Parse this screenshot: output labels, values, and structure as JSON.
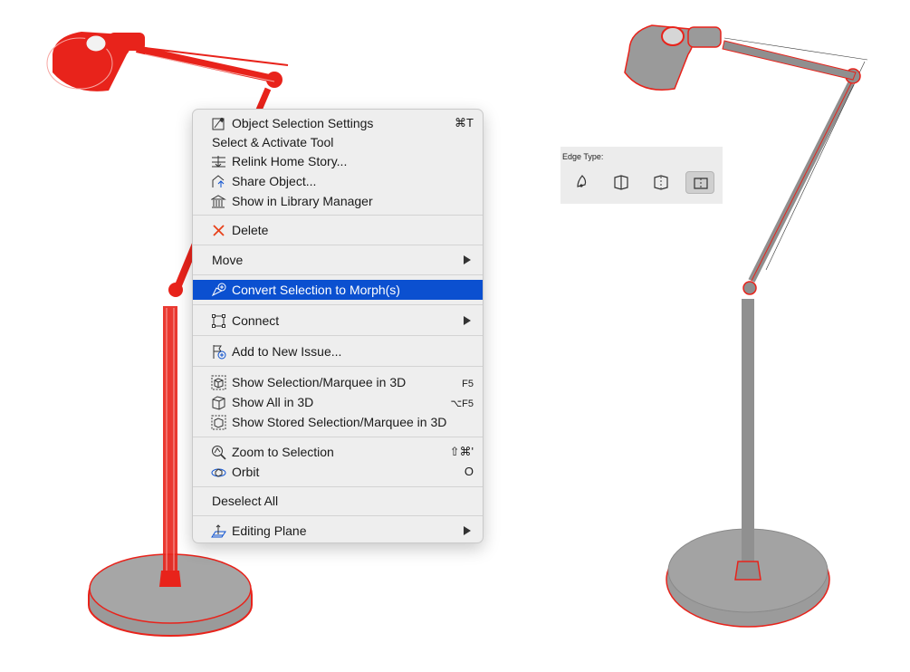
{
  "colors": {
    "accent": "#0b50d0",
    "selection_edge": "#e8231b",
    "model_fill": "#9b9b9b"
  },
  "context_menu": {
    "groups": [
      [
        {
          "label": "Object Selection Settings",
          "shortcut": "⌘T",
          "icon": "object-settings-icon"
        },
        {
          "label": "Select & Activate Tool",
          "shortcut": "",
          "icon": ""
        },
        {
          "label": "Relink Home Story...",
          "shortcut": "",
          "icon": "relink-story-icon"
        },
        {
          "label": "Share Object...",
          "shortcut": "",
          "icon": "share-object-icon"
        },
        {
          "label": "Show in Library Manager",
          "shortcut": "",
          "icon": "library-manager-icon"
        }
      ],
      [
        {
          "label": "Delete",
          "shortcut": "",
          "icon": "delete-x-icon"
        }
      ],
      [
        {
          "label": "Move",
          "submenu": true,
          "icon": ""
        }
      ],
      [
        {
          "label": "Convert Selection to Morph(s)",
          "highlighted": true,
          "icon": "convert-morph-icon"
        }
      ],
      [
        {
          "label": "Connect",
          "submenu": true,
          "icon": "connect-icon"
        }
      ],
      [
        {
          "label": "Add to New Issue...",
          "icon": "add-issue-icon"
        }
      ],
      [
        {
          "label": "Show Selection/Marquee in 3D",
          "shortcut": "F5",
          "icon": "show-selection-3d-icon"
        },
        {
          "label": "Show All in 3D",
          "shortcut": "⌥F5",
          "icon": "show-all-3d-icon"
        },
        {
          "label": "Show Stored Selection/Marquee in 3D",
          "shortcut": "",
          "icon": "show-stored-3d-icon"
        }
      ],
      [
        {
          "label": "Zoom to Selection",
          "shortcut": "⇧⌘'",
          "icon": "zoom-selection-icon"
        },
        {
          "label": "Orbit",
          "shortcut": "O",
          "icon": "orbit-icon"
        }
      ],
      [
        {
          "label": "Deselect All",
          "icon": ""
        }
      ],
      [
        {
          "label": "Editing Plane",
          "submenu": true,
          "icon": "editing-plane-icon"
        }
      ]
    ]
  },
  "edge_panel": {
    "title": "Edge Type:",
    "buttons": [
      {
        "name": "smooth-edge-icon",
        "selected": false
      },
      {
        "name": "hard-edge-icon",
        "selected": false
      },
      {
        "name": "soft-edge-icon",
        "selected": false
      },
      {
        "name": "hidden-edge-icon",
        "selected": true
      }
    ]
  }
}
